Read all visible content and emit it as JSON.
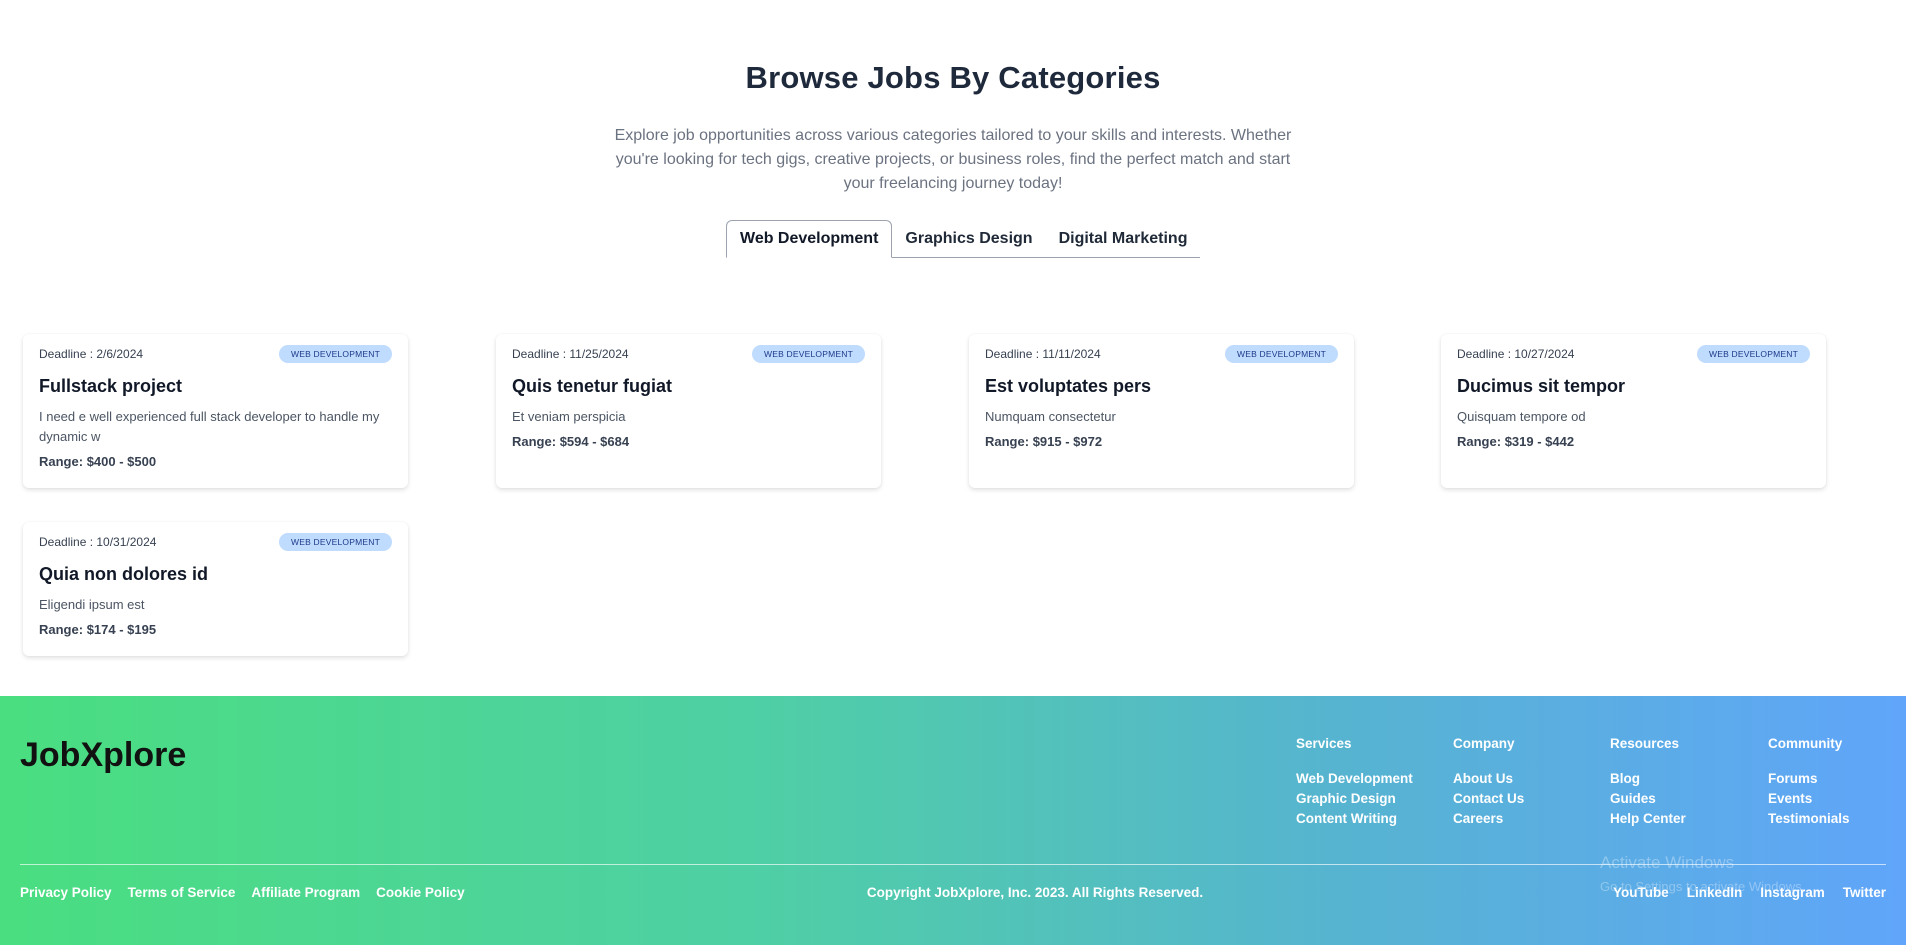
{
  "header": {
    "title": "Browse Jobs By Categories",
    "subtitle": "Explore job opportunities across various categories tailored to your skills and interests. Whether you're looking for tech gigs, creative projects, or business roles, find the perfect match and start your freelancing journey today!"
  },
  "tabs": [
    {
      "label": "Web Development",
      "active": true
    },
    {
      "label": "Graphics Design",
      "active": false
    },
    {
      "label": "Digital Marketing",
      "active": false
    }
  ],
  "jobs": [
    {
      "deadline": "Deadline : 2/6/2024",
      "category": "WEB DEVELOPMENT",
      "title": "Fullstack project",
      "description": "I need e well experienced full stack developer to handle my dynamic w",
      "range_label": "Range:",
      "range": "$400 - $500"
    },
    {
      "deadline": "Deadline : 11/25/2024",
      "category": "WEB DEVELOPMENT",
      "title": "Quis tenetur fugiat",
      "description": "Et veniam perspicia",
      "range_label": "Range:",
      "range": "$594 - $684"
    },
    {
      "deadline": "Deadline : 11/11/2024",
      "category": "WEB DEVELOPMENT",
      "title": "Est voluptates pers",
      "description": "Numquam consectetur",
      "range_label": "Range:",
      "range": "$915 - $972"
    },
    {
      "deadline": "Deadline : 10/27/2024",
      "category": "WEB DEVELOPMENT",
      "title": "Ducimus sit tempor",
      "description": "Quisquam tempore od",
      "range_label": "Range:",
      "range": "$319 - $442"
    },
    {
      "deadline": "Deadline : 10/31/2024",
      "category": "WEB DEVELOPMENT",
      "title": "Quia non dolores id",
      "description": "Eligendi ipsum est",
      "range_label": "Range:",
      "range": "$174 - $195"
    }
  ],
  "footer": {
    "logo": "JobXplore",
    "columns": [
      {
        "heading": "Services",
        "links": [
          "Web Development",
          "Graphic Design",
          "Content Writing"
        ]
      },
      {
        "heading": "Company",
        "links": [
          "About Us",
          "Contact Us",
          "Careers"
        ]
      },
      {
        "heading": "Resources",
        "links": [
          "Blog",
          "Guides",
          "Help Center"
        ]
      },
      {
        "heading": "Community",
        "links": [
          "Forums",
          "Events",
          "Testimonials"
        ]
      }
    ],
    "legal": [
      "Privacy Policy",
      "Terms of Service",
      "Affiliate Program",
      "Cookie Policy"
    ],
    "copyright": "Copyright JobXplore, Inc. 2023. All Rights Reserved.",
    "social": [
      "YouTube",
      "LinkedIn",
      "Instagram",
      "Twitter"
    ]
  },
  "watermark": {
    "line1": "Activate Windows",
    "line2": "Go to Settings to activate Windows."
  },
  "colors": {
    "badge_bg": "#bfdbfe",
    "footer_gradient_start": "#4ade80",
    "footer_gradient_end": "#60a5fa"
  }
}
